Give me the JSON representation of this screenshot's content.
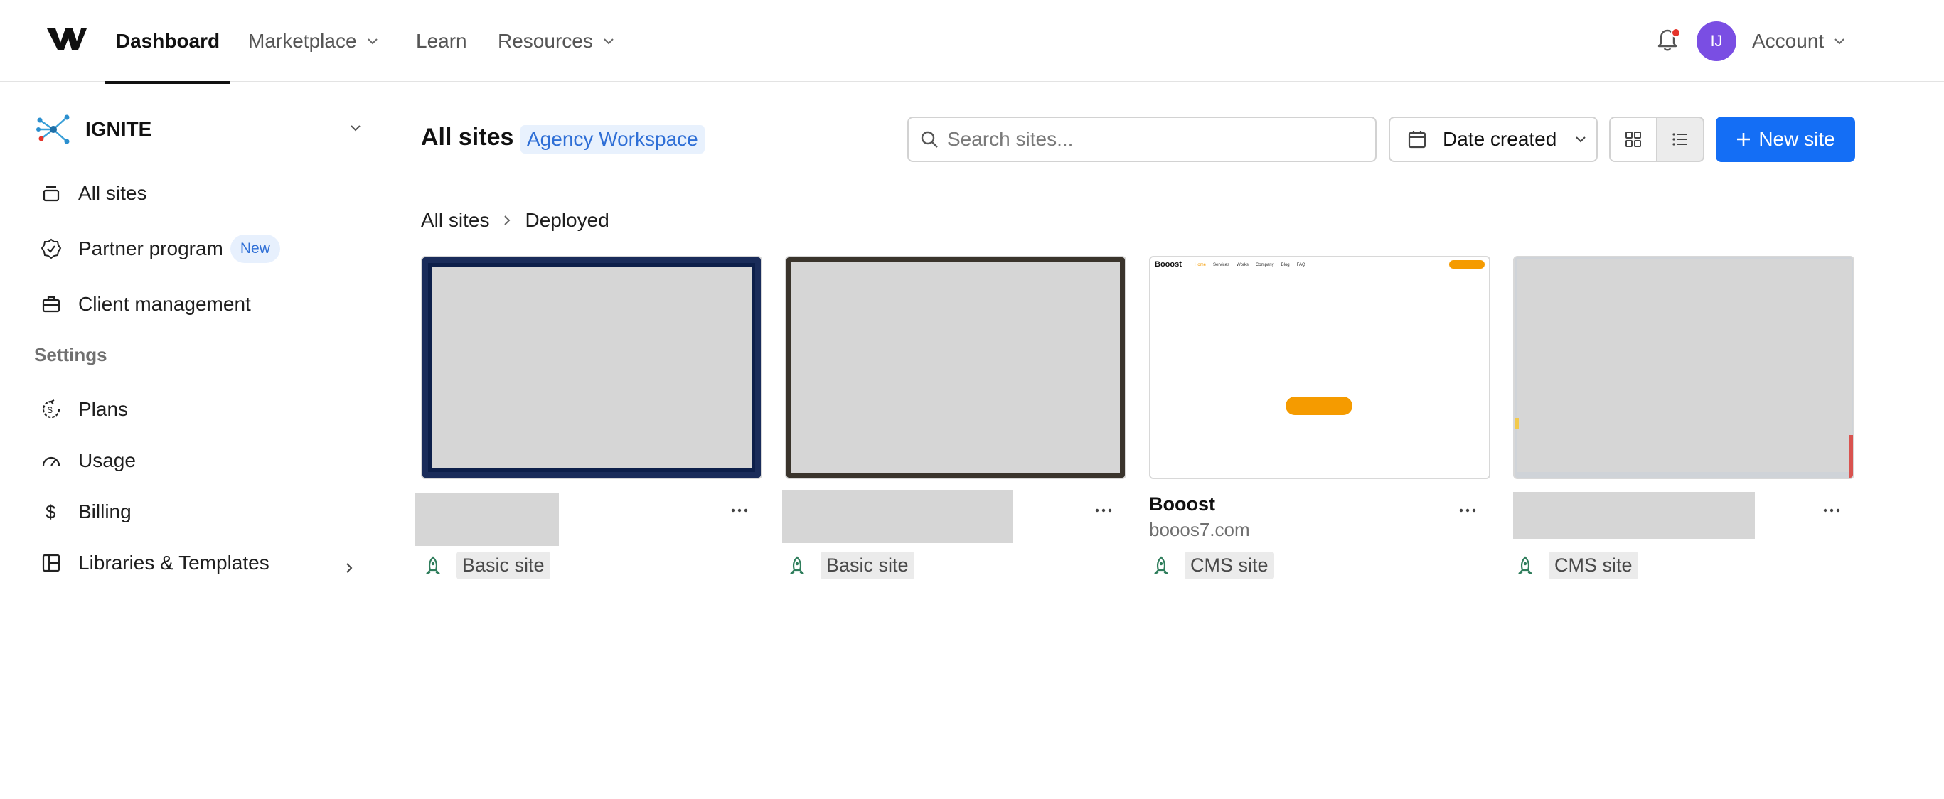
{
  "nav": {
    "items": [
      {
        "label": "Dashboard"
      },
      {
        "label": "Marketplace"
      },
      {
        "label": "Learn"
      },
      {
        "label": "Resources"
      }
    ],
    "avatar_initials": "IJ",
    "account_label": "Account"
  },
  "sidebar": {
    "workspace_name": "IGNITE",
    "items": [
      {
        "label": "All sites"
      },
      {
        "label": "Partner program",
        "badge": "New"
      },
      {
        "label": "Client management"
      }
    ],
    "settings_heading": "Settings",
    "settings_items": [
      {
        "label": "Plans"
      },
      {
        "label": "Usage"
      },
      {
        "label": "Billing"
      },
      {
        "label": "Libraries & Templates"
      }
    ]
  },
  "main": {
    "title": "All sites",
    "workspace_tag": "Agency Workspace",
    "search_placeholder": "Search sites...",
    "sort_label": "Date created",
    "new_site_label": "New site",
    "breadcrumb": [
      "All sites",
      "Deployed"
    ]
  },
  "sites": [
    {
      "plan": "Basic site"
    },
    {
      "plan": "Basic site"
    },
    {
      "name": "Booost",
      "domain": "booos7.com",
      "plan": "CMS site"
    },
    {
      "plan": "CMS site"
    }
  ],
  "thumbnail_booost": {
    "logo": "Booost",
    "nav": [
      "Home",
      "Services",
      "Works",
      "Company",
      "Blog",
      "FAQ"
    ]
  },
  "colors": {
    "accent": "#146ef5",
    "avatar": "#7a4ee3",
    "notification_dot": "#e5342b",
    "plan_icon": "#2e7d5b"
  }
}
